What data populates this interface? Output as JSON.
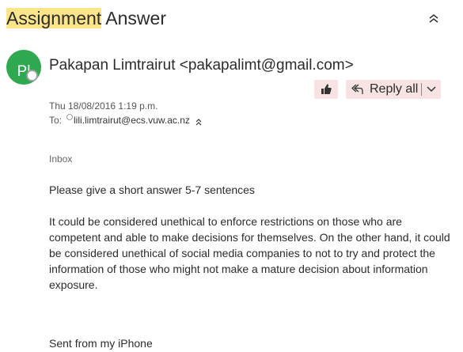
{
  "subject": {
    "highlighted": "Assignment",
    "rest": " Answer"
  },
  "header": {
    "collapse_icon": "double-chevron-up-icon",
    "avatar_initials": "Pl",
    "avatar_color": "#2fa84f",
    "sender": "Pakapan Limtrairut <pakapalimt@gmail.com>",
    "date": "Thu 18/08/2016 1:19 p.m.",
    "to_label": "To:",
    "recipient": "lili.limtrairut@ecs.vuw.ac.nz"
  },
  "actions": {
    "like_icon": "thumbs-up-icon",
    "reply_all_icon": "reply-all-icon",
    "reply_all_label": "Reply all",
    "dropdown_icon": "chevron-down-icon",
    "button_bg": "#f7e3e3"
  },
  "message": {
    "folder": "Inbox",
    "body_paragraphs": [
      "Please give a short answer 5-7 sentences",
      "It could be considered unethical to enforce restrictions on those who are competent and able to make decisions for themselves. On the other hand, it could be considered unethical of social media companies to not to try and protect the information of those who might not make a mature decision about information exposure."
    ],
    "signature": "Sent from my iPhone"
  }
}
